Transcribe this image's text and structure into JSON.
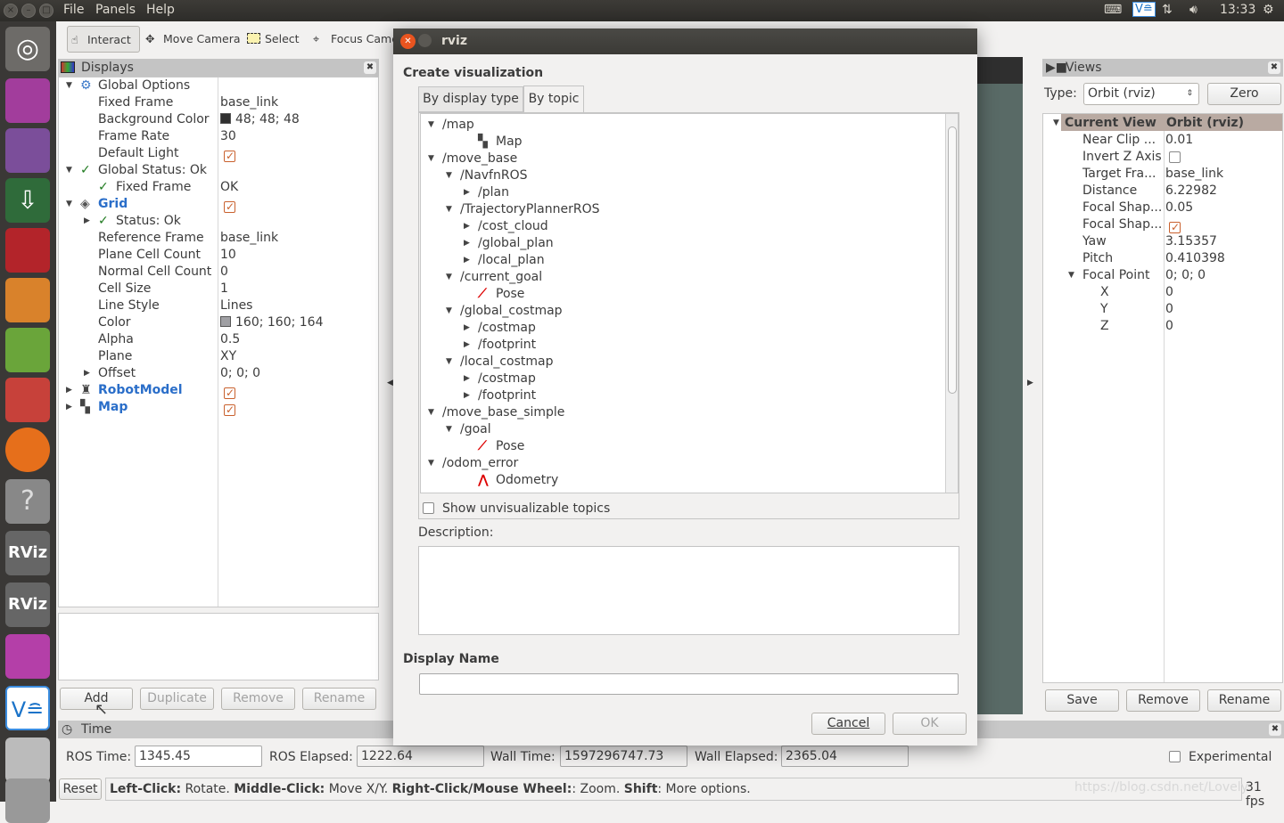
{
  "menubar": {
    "items": [
      "File",
      "Panels",
      "Help"
    ],
    "clock": "13:33"
  },
  "toolbar": {
    "tools": [
      {
        "label": "Interact",
        "icon": "hand-icon"
      },
      {
        "label": "Move Camera",
        "icon": "move-camera-icon"
      },
      {
        "label": "Select",
        "icon": "select-icon"
      },
      {
        "label": "Focus Camera",
        "icon": "focus-camera-icon"
      }
    ]
  },
  "displays": {
    "title": "Displays",
    "rows": [
      {
        "d": 0,
        "exp": "▼",
        "icon": "gear",
        "label": "Global Options",
        "value": ""
      },
      {
        "d": 1,
        "label": "Fixed Frame",
        "value": "base_link"
      },
      {
        "d": 1,
        "label": "Background Color",
        "value": "48; 48; 48",
        "swatch": "#303030"
      },
      {
        "d": 1,
        "label": "Frame Rate",
        "value": "30"
      },
      {
        "d": 1,
        "label": "Default Light",
        "check": true
      },
      {
        "d": 0,
        "exp": "▼",
        "icon": "check",
        "label": "Global Status: Ok",
        "value": ""
      },
      {
        "d": 1,
        "icon": "check",
        "label": "Fixed Frame",
        "value": "OK"
      },
      {
        "d": 0,
        "exp": "▼",
        "icon": "grid",
        "label": "Grid",
        "blue": true,
        "check": true
      },
      {
        "d": 1,
        "exp": "▶",
        "icon": "check",
        "label": "Status: Ok",
        "value": ""
      },
      {
        "d": 1,
        "label": "Reference Frame",
        "value": "base_link"
      },
      {
        "d": 1,
        "label": "Plane Cell Count",
        "value": "10"
      },
      {
        "d": 1,
        "label": "Normal Cell Count",
        "value": "0"
      },
      {
        "d": 1,
        "label": "Cell Size",
        "value": "1"
      },
      {
        "d": 1,
        "label": "Line Style",
        "value": "Lines"
      },
      {
        "d": 1,
        "label": "Color",
        "value": "160; 160; 164",
        "swatch": "#a0a0a4"
      },
      {
        "d": 1,
        "label": "Alpha",
        "value": "0.5"
      },
      {
        "d": 1,
        "label": "Plane",
        "value": "XY"
      },
      {
        "d": 1,
        "exp": "▶",
        "label": "Offset",
        "value": "0; 0; 0"
      },
      {
        "d": 0,
        "exp": "▶",
        "icon": "robot",
        "label": "RobotModel",
        "blue": true,
        "check": true
      },
      {
        "d": 0,
        "exp": "▶",
        "icon": "map",
        "label": "Map",
        "blue": true,
        "check": true
      }
    ],
    "buttons": {
      "add": "Add",
      "duplicate": "Duplicate",
      "remove": "Remove",
      "rename": "Rename"
    }
  },
  "dialog": {
    "window_title": "rviz",
    "heading": "Create visualization",
    "tabs": [
      "By display type",
      "By topic"
    ],
    "active_tab": "By topic",
    "topics": [
      {
        "d": 0,
        "exp": "▼",
        "label": "/map"
      },
      {
        "d": 2,
        "icon": "map",
        "label": "Map"
      },
      {
        "d": 0,
        "exp": "▼",
        "label": "/move_base"
      },
      {
        "d": 1,
        "exp": "▼",
        "label": "/NavfnROS"
      },
      {
        "d": 2,
        "exp": "▶",
        "label": "/plan"
      },
      {
        "d": 1,
        "exp": "▼",
        "label": "/TrajectoryPlannerROS"
      },
      {
        "d": 2,
        "exp": "▶",
        "label": "/cost_cloud"
      },
      {
        "d": 2,
        "exp": "▶",
        "label": "/global_plan"
      },
      {
        "d": 2,
        "exp": "▶",
        "label": "/local_plan"
      },
      {
        "d": 1,
        "exp": "▼",
        "label": "/current_goal"
      },
      {
        "d": 2,
        "icon": "pose",
        "label": "Pose"
      },
      {
        "d": 1,
        "exp": "▼",
        "label": "/global_costmap"
      },
      {
        "d": 2,
        "exp": "▶",
        "label": "/costmap"
      },
      {
        "d": 2,
        "exp": "▶",
        "label": "/footprint"
      },
      {
        "d": 1,
        "exp": "▼",
        "label": "/local_costmap"
      },
      {
        "d": 2,
        "exp": "▶",
        "label": "/costmap"
      },
      {
        "d": 2,
        "exp": "▶",
        "label": "/footprint"
      },
      {
        "d": 0,
        "exp": "▼",
        "label": "/move_base_simple"
      },
      {
        "d": 1,
        "exp": "▼",
        "label": "/goal"
      },
      {
        "d": 2,
        "icon": "pose",
        "label": "Pose"
      },
      {
        "d": 0,
        "exp": "▼",
        "label": "/odom_error"
      },
      {
        "d": 2,
        "icon": "odom",
        "label": "Odometry"
      }
    ],
    "show_unvisualizable": "Show unvisualizable topics",
    "description_label": "Description:",
    "display_name_label": "Display Name",
    "display_name_value": "",
    "cancel": "Cancel",
    "ok": "OK"
  },
  "views": {
    "title": "Views",
    "type_label": "Type:",
    "type_value": "Orbit (rviz)",
    "zero": "Zero",
    "header": [
      "Current View",
      "Orbit (rviz)"
    ],
    "rows": [
      {
        "d": 1,
        "label": "Near Clip ...",
        "value": "0.01"
      },
      {
        "d": 1,
        "label": "Invert Z Axis",
        "check": false
      },
      {
        "d": 1,
        "label": "Target Fra...",
        "value": "base_link"
      },
      {
        "d": 1,
        "label": "Distance",
        "value": "6.22982"
      },
      {
        "d": 1,
        "label": "Focal Shap...",
        "value": "0.05"
      },
      {
        "d": 1,
        "label": "Focal Shap...",
        "check": true
      },
      {
        "d": 1,
        "label": "Yaw",
        "value": "3.15357"
      },
      {
        "d": 1,
        "label": "Pitch",
        "value": "0.410398"
      },
      {
        "d": 1,
        "exp": "▼",
        "label": "Focal Point",
        "value": "0; 0; 0"
      },
      {
        "d": 2,
        "label": "X",
        "value": "0"
      },
      {
        "d": 2,
        "label": "Y",
        "value": "0"
      },
      {
        "d": 2,
        "label": "Z",
        "value": "0"
      }
    ],
    "save": "Save",
    "remove": "Remove",
    "rename": "Rename"
  },
  "time": {
    "title": "Time",
    "ros_time_label": "ROS Time:",
    "ros_time": "1345.45",
    "ros_elapsed_label": "ROS Elapsed:",
    "ros_elapsed": "1222.64",
    "wall_time_label": "Wall Time:",
    "wall_time": "1597296747.73",
    "wall_elapsed_label": "Wall Elapsed:",
    "wall_elapsed": "2365.04",
    "experimental": "Experimental"
  },
  "status": {
    "reset": "Reset",
    "parts": [
      [
        "Left-Click:",
        true
      ],
      [
        " Rotate. ",
        false
      ],
      [
        "Middle-Click:",
        true
      ],
      [
        " Move X/Y. ",
        false
      ],
      [
        "Right-Click/Mouse Wheel:",
        true
      ],
      [
        ": Zoom. ",
        false
      ],
      [
        "Shift",
        true
      ],
      [
        ": More options.",
        false
      ]
    ],
    "watermark": "https://blog.csdn.net/Lovely",
    "fps": "31 fps"
  }
}
